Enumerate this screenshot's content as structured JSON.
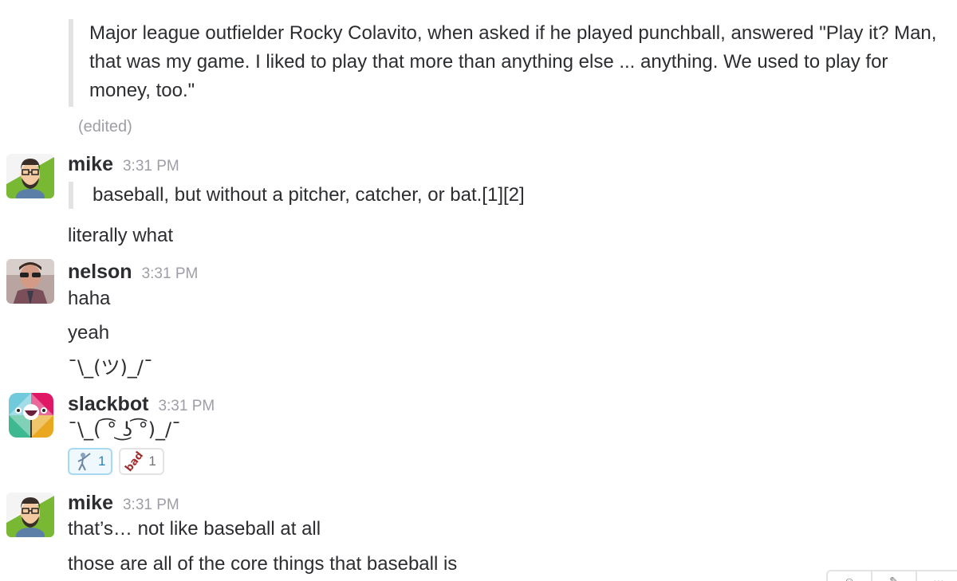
{
  "messages": {
    "quote_previous": {
      "line1": "Major league outfielder Rocky Colavito, when asked if he played punchball, answered \"Play it? Man,",
      "line2": "that was my game. I liked to play that more than anything else ... anything. We used to play for",
      "line3": "money, too.\"",
      "edited_label": "(edited)"
    },
    "mike_1": {
      "author": "mike",
      "time": "3:31 PM",
      "quote": "baseball, but without a pitcher, catcher, or bat.[1][2]",
      "followup": "literally what"
    },
    "nelson": {
      "author": "nelson",
      "time": "3:31 PM",
      "lines": [
        "haha",
        "yeah",
        "¯\\_(ツ)_/¯"
      ]
    },
    "slackbot": {
      "author": "slackbot",
      "time": "3:31 PM",
      "text": "¯\\_( ͡° ͜ʖ ͡°)_/¯",
      "reactions": [
        {
          "emoji": "person-fencing-icon",
          "count": "1",
          "active": true
        },
        {
          "emoji": "bad",
          "count": "1",
          "active": false
        }
      ]
    },
    "mike_2": {
      "author": "mike",
      "time": "3:31 PM",
      "lines": [
        "that’s… not like baseball at all",
        "those are all of the core things that baseball is"
      ]
    }
  },
  "hover_toolbar": {
    "icons": [
      "emoji-reaction-icon",
      "comment-icon",
      "more-icon"
    ]
  },
  "colors": {
    "text": "#2c2d30",
    "muted": "#9e9ea6",
    "quote_bar": "#e3e3e3",
    "reaction_active_border": "#a8d9f3",
    "reaction_active_bg": "#eef8fd",
    "reaction_active_text": "#2a80b9"
  }
}
